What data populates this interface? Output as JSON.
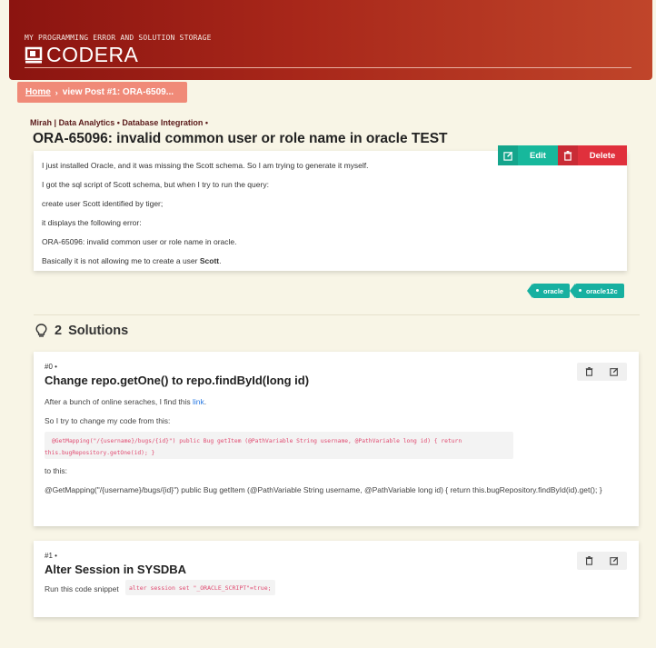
{
  "header": {
    "tagline": "MY PROGRAMMING ERROR AND SOLUTION STORAGE",
    "brand": "CODERA"
  },
  "breadcrumb": {
    "home": "Home",
    "current": "view Post #1: ORA-6509..."
  },
  "post": {
    "author": "Mirah",
    "categories": "Data Analytics • Database Integration •",
    "title": "ORA-65096: invalid common user or role name in oracle TEST",
    "body": [
      "I just installed Oracle, and it was missing the Scott schema. So I am trying to generate it myself.",
      "I got the sql script of Scott schema, but when I try to run the query:",
      "create user Scott identified by tiger;",
      "it displays the following error:",
      "ORA-65096: invalid common user or role name in oracle.",
      "Basically it is not allowing me to create a user"
    ],
    "body_bold": "Scott",
    "body_end": ".",
    "edit_label": "Edit",
    "delete_label": "Delete",
    "tags": [
      "oracle",
      "oracle12c"
    ]
  },
  "solutions": {
    "count": "2",
    "heading": "Solutions",
    "items": [
      {
        "index": "#0 •",
        "title": "Change repo.getOne() to repo.findById(long id)",
        "intro": "After a bunch of online seraches, I find this",
        "link": "link",
        "intro_end": ".",
        "line2": "So I try to change my code from this:",
        "code_line1": "@GetMapping(\"/{username}/bugs/{id}\") public Bug getItem (@PathVariable String username, @PathVariable long id) { return",
        "code_line2": "this.bugRepository.getOne(id); }",
        "line3": "to this:",
        "line4": "@GetMapping(\"/{username}/bugs/{id}\") public Bug getItem (@PathVariable String username, @PathVariable long id) { return this.bugRepository.findById(id).get(); }"
      },
      {
        "index": "#1 •",
        "title": "Alter Session in SYSDBA",
        "intro": "Run this code snippet",
        "code": "alter session set \"_ORACLE_SCRIPT\"=true;"
      }
    ]
  },
  "colors": {
    "header_start": "#8b1410",
    "header_end": "#c0452a",
    "breadcrumb": "#f08a78",
    "edit": "#17b89c",
    "delete": "#e0303c",
    "tag": "#17b0a0",
    "code": "#e04a70"
  },
  "icons": {
    "brand": "screen-icon",
    "edit": "pencil-square-icon",
    "delete": "trash-icon",
    "solutions": "lightbulb-icon"
  }
}
